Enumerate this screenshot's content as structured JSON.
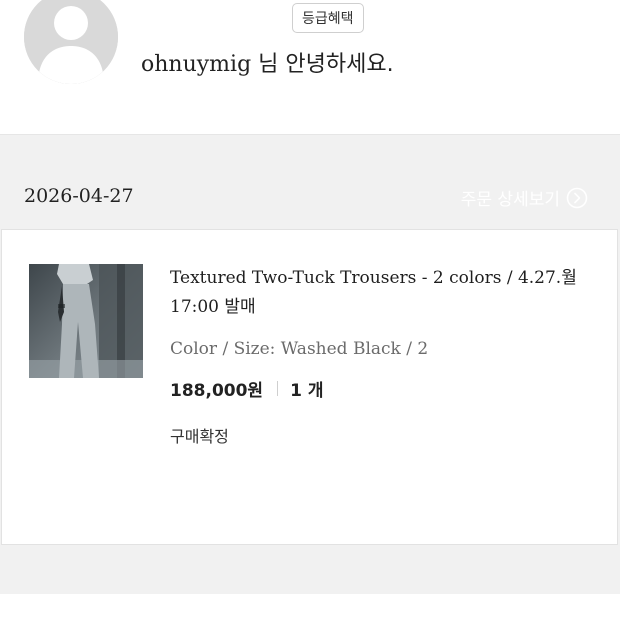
{
  "profile": {
    "username": "ohnuymig",
    "greeting_suffix": " 님 안녕하세요.",
    "grade_button_label": "등급혜택"
  },
  "order": {
    "date": "2026-04-27",
    "detail_link_label": "주문 상세보기",
    "product": {
      "name": "Textured Two-Tuck Trousers - 2 colors / 4.27.월 17:00 발매",
      "option": "Color / Size: Washed Black / 2",
      "price": "188,000원",
      "quantity": "1 개",
      "status": "구매확정"
    }
  },
  "colors": {
    "section_background": "#f1f1f1",
    "card_background": "#ffffff",
    "avatar_gray": "#d9d9d9"
  },
  "icons": {
    "avatar": "user-placeholder-icon",
    "detail_link": "chevron-right-circle-icon"
  }
}
